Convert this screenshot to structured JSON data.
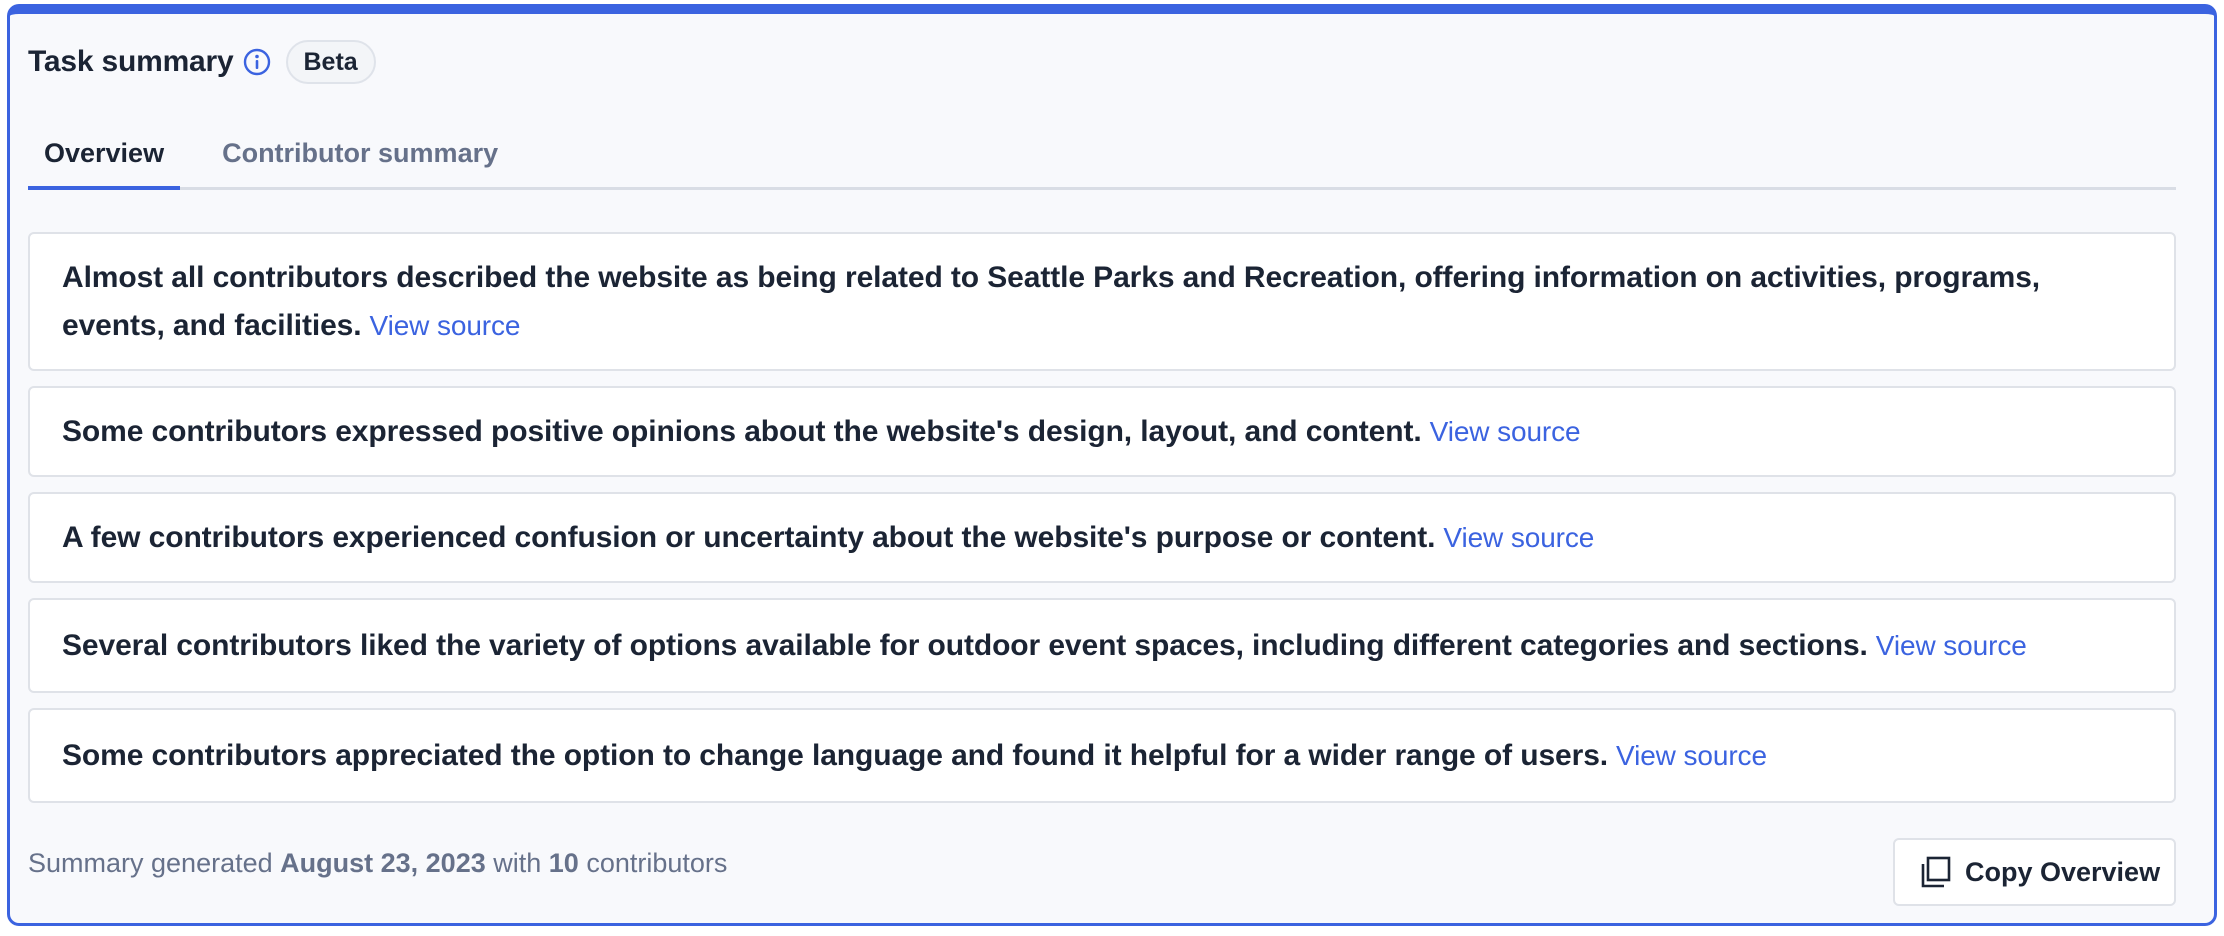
{
  "header": {
    "title": "Task summary",
    "info_icon": "info-circle-icon",
    "badge": "Beta"
  },
  "tabs": [
    {
      "label": "Overview",
      "active": true
    },
    {
      "label": "Contributor summary",
      "active": false
    }
  ],
  "summary_items": [
    {
      "text": "Almost all contributors described the website as being related to Seattle Parks and Recreation, offering information on activities, programs, events, and facilities.",
      "link": "View source"
    },
    {
      "text": "Some contributors expressed positive opinions about the website's design, layout, and content.",
      "link": "View source"
    },
    {
      "text": "A few contributors experienced confusion or uncertainty about the website's purpose or content.",
      "link": "View source"
    },
    {
      "text": "Several contributors liked the variety of options available for outdoor event spaces, including different categories and sections.",
      "link": "View source"
    },
    {
      "text": "Some contributors appreciated the option to change language and found it helpful for a wider range of users.",
      "link": "View source"
    }
  ],
  "footer": {
    "prefix": "Summary generated",
    "date": "August 23, 2023",
    "middle": "with",
    "count": "10",
    "suffix": "contributors"
  },
  "copy_button": {
    "label": "Copy Overview",
    "icon": "copy-icon"
  },
  "colors": {
    "accent": "#3b63e0",
    "text": "#1b2434",
    "muted": "#66718a"
  }
}
